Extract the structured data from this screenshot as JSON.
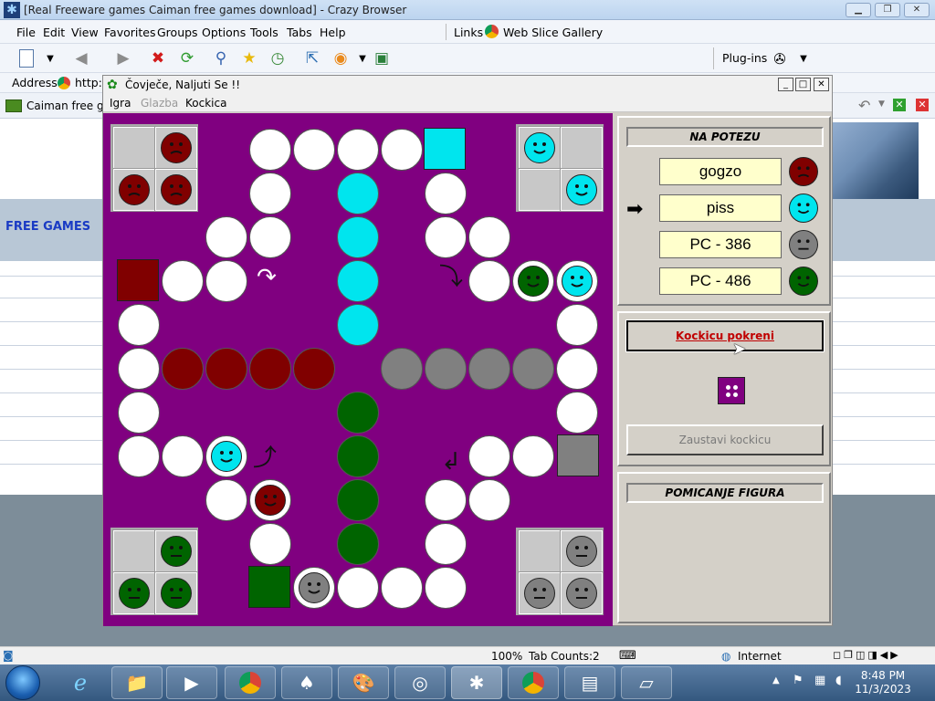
{
  "browser": {
    "title": "[Real Freeware games Caiman free games download] - Crazy Browser",
    "menu": [
      "File",
      "Edit",
      "View",
      "Favorites",
      "Groups",
      "Options",
      "Tools",
      "Tabs",
      "Help"
    ],
    "links_label": "Links",
    "web_slice": "Web Slice Gallery",
    "plugins": "Plug-ins",
    "address_label": "Address",
    "address_value": "http:",
    "tab_title": "Caiman free g",
    "page_text": "FREE GAMES"
  },
  "status": {
    "zoom": "100%",
    "tab_counts": "Tab Counts:2",
    "zone": "Internet"
  },
  "taskbar": {
    "time": "8:48 PM",
    "date": "11/3/2023"
  },
  "game": {
    "title": "Čovječe, Naljuti Se !!",
    "menu": [
      "Igra",
      "Glazba",
      "Kockica"
    ],
    "turn_title": "NA POTEZU",
    "players": [
      {
        "name": "gogzo",
        "color": "#800000"
      },
      {
        "name": "piss",
        "color": "#00e5ee"
      },
      {
        "name": "PC - 386",
        "color": "#808080"
      },
      {
        "name": "PC - 486",
        "color": "#006400"
      }
    ],
    "current_player_index": 1,
    "roll_button": "Kockicu pokreni",
    "stop_button": "Zaustavi kockicu",
    "die_value": 4,
    "move_title": "POMICANJE FIGURA"
  }
}
